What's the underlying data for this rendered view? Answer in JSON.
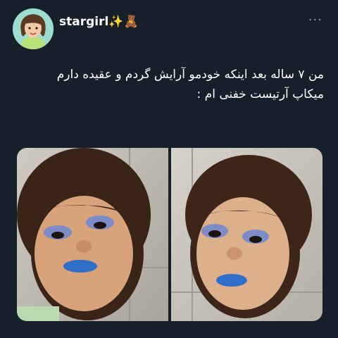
{
  "tweet": {
    "author": {
      "display_name": "stargirl✨🧸",
      "avatar_icon": "cartoon-girl-avatar-icon"
    },
    "more_label": "···",
    "text_line1": "من ۷ ساله بعد اینکه خودمو آرایش گردم و عقیده دارم",
    "text_line2": "میکاپ آرتیست خفنی ام :",
    "media": [
      {
        "icon": "photo-child-makeup-icon"
      },
      {
        "icon": "photo-child-makeup-icon"
      }
    ]
  },
  "colors": {
    "background": "#15202b",
    "text": "#ffffff",
    "muted": "#8899a6",
    "eyeshadow": "#7d8cc6",
    "lipstick": "#2f6fc9"
  }
}
